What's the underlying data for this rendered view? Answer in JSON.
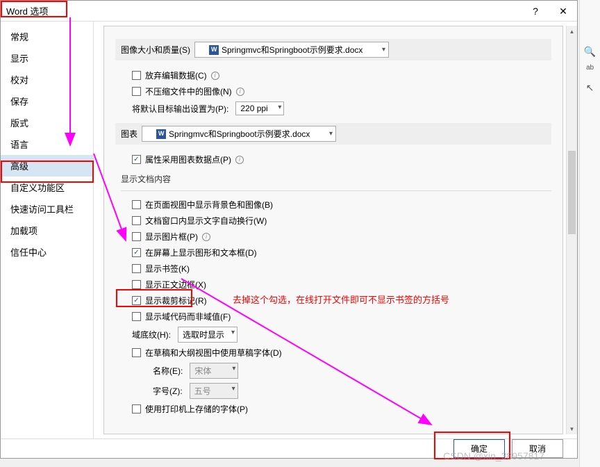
{
  "dialog": {
    "title": "Word 选项",
    "help_icon": "?",
    "close_icon": "✕"
  },
  "sidebar": {
    "items": [
      {
        "label": "常规"
      },
      {
        "label": "显示"
      },
      {
        "label": "校对"
      },
      {
        "label": "保存"
      },
      {
        "label": "版式"
      },
      {
        "label": "语言"
      },
      {
        "label": "高级",
        "selected": true
      },
      {
        "label": "自定义功能区"
      },
      {
        "label": "快速访问工具栏"
      },
      {
        "label": "加载项"
      },
      {
        "label": "信任中心"
      }
    ]
  },
  "content": {
    "image_section": {
      "header_label": "图像大小和质量(S)",
      "doc_name": "Springmvc和Springboot示例要求.docx",
      "discard_edit": "放弃编辑数据(C)",
      "no_compress": "不压缩文件中的图像(N)",
      "default_output_label": "将默认目标输出设置为(P):",
      "default_output_value": "220 ppi"
    },
    "chart_section": {
      "header_label": "图表",
      "doc_name": "Springmvc和Springboot示例要求.docx",
      "use_chart_data": "属性采用图表数据点(P)"
    },
    "doc_content_section": {
      "title": "显示文档内容",
      "bg_page_view": "在页面视图中显示背景色和图像(B)",
      "wrap_text": "文档窗口内显示文字自动换行(W)",
      "show_placeholder": "显示图片框(P)",
      "show_drawings": "在屏幕上显示图形和文本框(D)",
      "show_bookmarks": "显示书签(K)",
      "show_text_bounds": "显示正文边框(X)",
      "show_crop_marks": "显示裁剪标记(R)",
      "show_field_codes": "显示域代码而非域值(F)",
      "field_shading_label": "域底纹(H):",
      "field_shading_value": "选取时显示",
      "draft_font": "在草稿和大纲视图中使用草稿字体(D)",
      "font_name_label": "名称(E):",
      "font_name_value": "宋体",
      "font_size_label": "字号(Z):",
      "font_size_value": "五号",
      "printer_fonts": "使用打印机上存储的字体(P)"
    }
  },
  "annotation": {
    "bookmark_note": "去掉这个勾选，在线打开文件即可不显示书签的方括号"
  },
  "footer": {
    "ok": "确定",
    "cancel": "取消"
  },
  "watermark": "CSDN @xin_38957817",
  "right_panel": {
    "binoculars": "🔍",
    "replace": "ab",
    "cursor": "↖"
  }
}
